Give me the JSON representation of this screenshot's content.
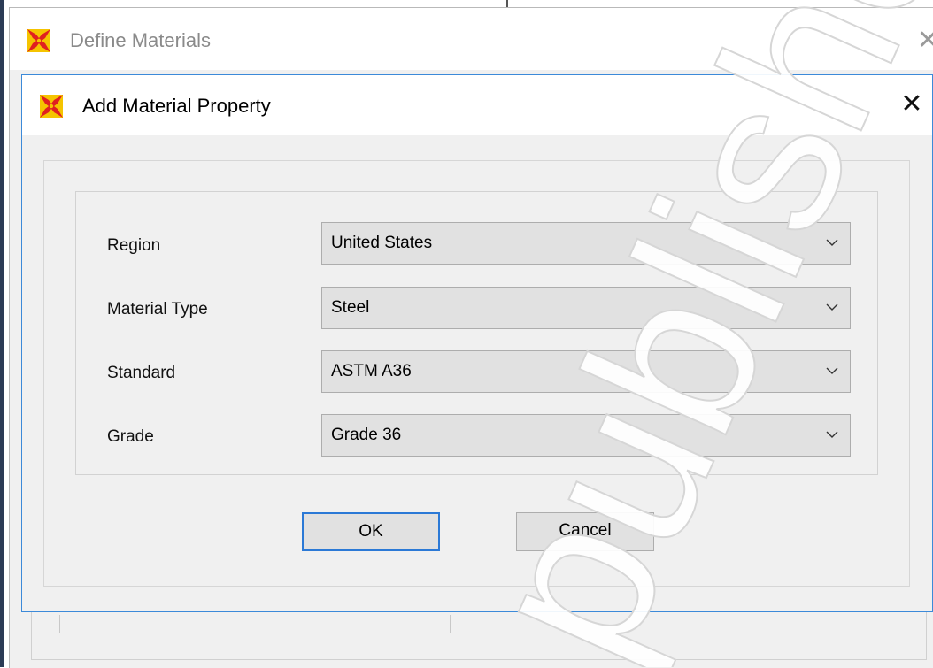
{
  "background_window": {
    "title": "Define Materials",
    "close_glyph": "✕",
    "icon": "etabs-app-icon"
  },
  "dialog": {
    "title": "Add Material Property",
    "close_glyph": "✕",
    "icon": "etabs-app-icon",
    "fields": [
      {
        "label": "Region",
        "value": "United States"
      },
      {
        "label": "Material Type",
        "value": "Steel"
      },
      {
        "label": "Standard",
        "value": "ASTM A36"
      },
      {
        "label": "Grade",
        "value": "Grade 36"
      }
    ],
    "ok_label": "OK",
    "cancel_label": "Cancel"
  },
  "watermark": {
    "text": "publishe"
  },
  "colors": {
    "accent": "#2b79d6",
    "dialog_border": "#3c8ad9",
    "control_bg": "#e1e1e1",
    "window_bg": "#f0f0f0",
    "icon_red": "#e02020",
    "icon_yellow": "#f5c400"
  }
}
